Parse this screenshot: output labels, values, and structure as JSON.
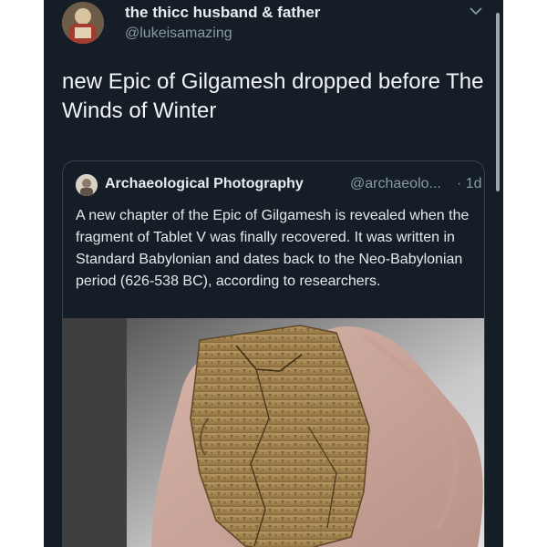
{
  "tweet": {
    "author_name": "the thicc husband & father",
    "author_handle": "@lukeisamazing",
    "avatar_icon": "user-avatar",
    "menu_icon": "chevron-down-icon",
    "text": "new Epic of Gilgamesh dropped before The Winds of Winter"
  },
  "quoted_tweet": {
    "author_name": "Archaeological Photography",
    "author_handle": "@archaeolo...",
    "timestamp": "· 1d",
    "avatar_icon": "user-avatar",
    "text": "A new chapter of the Epic of Gilgamesh is revealed when the fragment of Tablet V was finally recovered. It was written in Standard Babylonian and dates back to the Neo-Babylonian period (626-538 BC), according to researchers.",
    "image_subject": "clay cuneiform tablet held in gloved hand"
  },
  "colors": {
    "background": "#151d27",
    "primary_text": "#f2f4f5",
    "secondary_text": "#8899a6",
    "border": "#38444d"
  }
}
